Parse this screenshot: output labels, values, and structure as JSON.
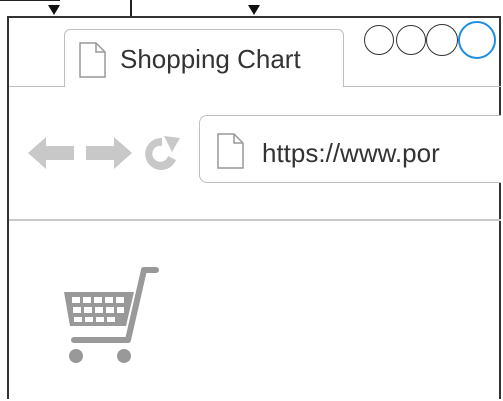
{
  "browser": {
    "tab": {
      "title": "Shopping Chart",
      "icon": "document-icon"
    },
    "window_controls": {
      "buttons": [
        {
          "name": "close",
          "color": "#333333"
        },
        {
          "name": "minimize",
          "color": "#333333"
        },
        {
          "name": "maximize",
          "color": "#1e8ee0"
        }
      ]
    },
    "toolbar": {
      "back_icon": "left-arrow-icon",
      "forward_icon": "right-arrow-icon",
      "reload_icon": "reload-icon",
      "address": {
        "value": "https://www.por",
        "icon": "document-icon"
      }
    }
  },
  "content": {
    "cart_icon": "shopping-cart-icon"
  },
  "colors": {
    "frame": "#333333",
    "icon_gray": "#c8c8c8",
    "cart_gray": "#999999",
    "accent_blue": "#1e8ee0"
  }
}
